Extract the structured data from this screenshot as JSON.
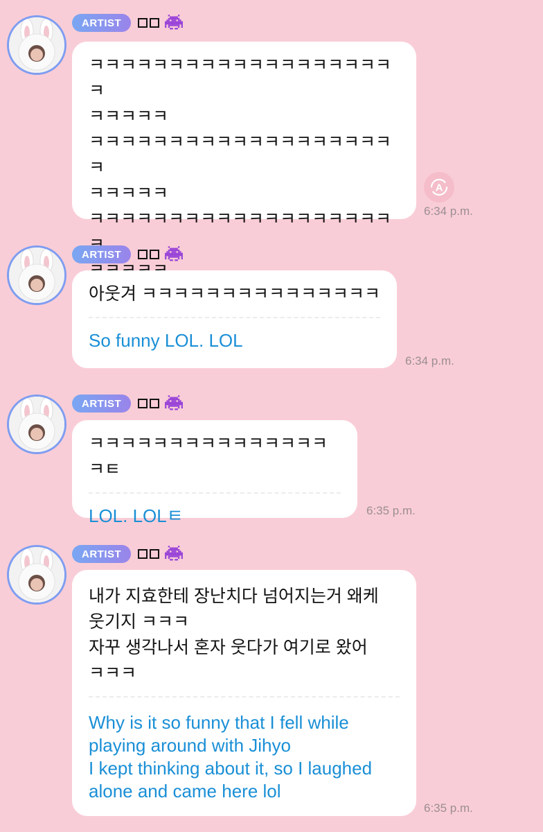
{
  "colors": {
    "background": "#f9cdd7",
    "badge_start": "#79a7f2",
    "badge_end": "#9a84ea",
    "translation_text": "#1a8fd6",
    "timestamp": "#9b8e93"
  },
  "messages": [
    {
      "badge": "ARTIST",
      "original": "ㅋㅋㅋㅋㅋㅋㅋㅋㅋㅋㅋㅋㅋㅋㅋㅋㅋㅋㅋㅋ\nㅋㅋㅋㅋㅋ\nㅋㅋㅋㅋㅋㅋㅋㅋㅋㅋㅋㅋㅋㅋㅋㅋㅋㅋㅋㅋ\nㅋㅋㅋㅋㅋ\nㅋㅋㅋㅋㅋㅋㅋㅋㅋㅋㅋㅋㅋㅋㅋㅋㅋㅋㅋㅋ\nㅋㅋㅋㅋㅋ",
      "translation": "",
      "time": "6:34 p.m.",
      "translate_icon": "translate-icon"
    },
    {
      "badge": "ARTIST",
      "original": "아웃겨 ㅋㅋㅋㅋㅋㅋㅋㅋㅋㅋㅋㅋㅋㅋㅋ",
      "translation": "So funny LOL. LOL",
      "time": "6:34 p.m."
    },
    {
      "badge": "ARTIST",
      "original": "ㅋㅋㅋㅋㅋㅋㅋㅋㅋㅋㅋㅋㅋㅋㅋㅋㅌ",
      "translation": "LOL. LOLㅌ",
      "time": "6:35 p.m."
    },
    {
      "badge": "ARTIST",
      "original": "내가 지효한테 장난치다 넘어지는거 왜케\n웃기지 ㅋㅋㅋ\n자꾸 생각나서 혼자 웃다가 여기로 왔어\nㅋㅋㅋ",
      "translation": "Why is it so funny that I fell while\nplaying around with Jihyo\nI kept thinking about it, so I laughed\nalone and came here lol",
      "time": "6:35 p.m."
    }
  ]
}
